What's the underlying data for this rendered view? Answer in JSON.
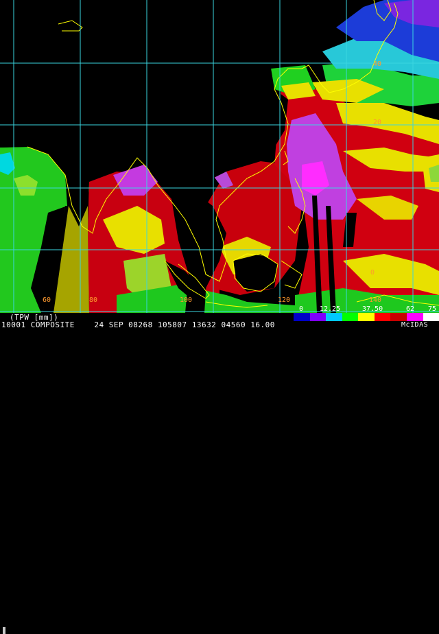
{
  "title_line": "(TPW [mm])",
  "info_line": "10001 COMPOSITE    24 SEP 08268 105807 13632 04560 16.00",
  "legend": {
    "ticks": [
      "0",
      "12.25",
      "37.50",
      "62",
      "75"
    ],
    "colors": [
      "#0000c8",
      "#7f00ff",
      "#00c8ff",
      "#00ff00",
      "#ffff00",
      "#ff0000",
      "#c80000",
      "#ff00ff",
      "#ffffff"
    ]
  },
  "credit": "McIDAS",
  "grid_labels": {
    "lat": [
      "40",
      "20",
      "0"
    ],
    "lon": [
      "60",
      "80",
      "100",
      "120",
      "140"
    ]
  },
  "colors": {
    "grid": "#3ad6e0",
    "coast": "#ffff00",
    "background": "#000000"
  }
}
